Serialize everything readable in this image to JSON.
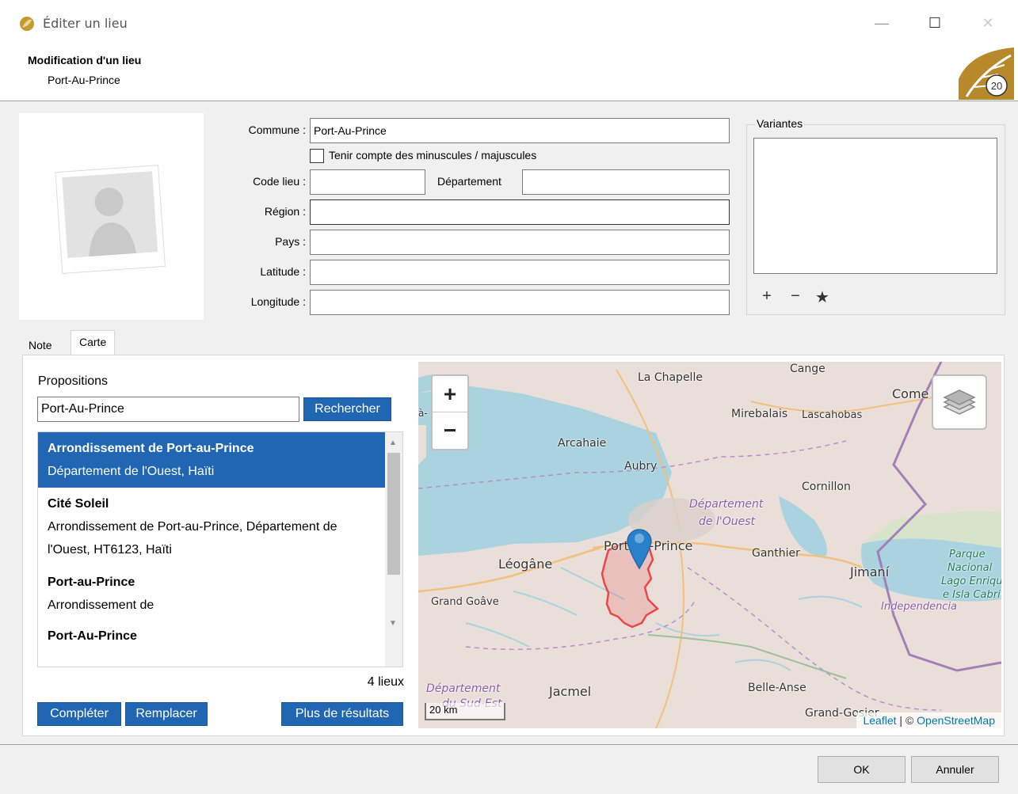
{
  "window": {
    "title": "Éditer un lieu",
    "minimize": "—",
    "maximize": "☐",
    "close": "✕"
  },
  "header": {
    "heading": "Modification d'un lieu",
    "subheading": "Port-Au-Prince"
  },
  "form": {
    "commune_label": "Commune :",
    "commune_value": "Port-Au-Prince",
    "case_label": "Tenir compte des minuscules / majuscules",
    "case_checked": false,
    "code_label": "Code lieu :",
    "code_value": "",
    "departement_label": "Département",
    "departement_value": "",
    "region_label": "Région :",
    "region_value": "",
    "pays_label": "Pays :",
    "pays_value": "",
    "latitude_label": "Latitude :",
    "latitude_value": "",
    "longitude_label": "Longitude :",
    "longitude_value": ""
  },
  "variantes": {
    "title": "Variantes",
    "add": "+",
    "remove": "−",
    "star": "★"
  },
  "tabs": [
    {
      "label": "Note"
    },
    {
      "label": "Carte"
    }
  ],
  "proposals": {
    "title": "Propositions",
    "query": "Port-Au-Prince",
    "search_button": "Rechercher",
    "items": [
      {
        "name": "Arrondissement de Port-au-Prince",
        "detail": "Département de l'Ouest, Haïti"
      },
      {
        "name": "Cité Soleil",
        "detail": "Arrondissement de Port-au-Prince, Département de l'Ouest, HT6123, Haïti"
      },
      {
        "name": "Port-au-Prince",
        "detail": "Arrondissement de"
      },
      {
        "name": "Port-Au-Prince",
        "detail": ""
      }
    ],
    "count": "4 lieux",
    "complete_button": "Compléter",
    "replace_button": "Remplacer",
    "more_button": "Plus de résultats"
  },
  "map": {
    "zoom_in": "+",
    "zoom_out": "−",
    "scale": "20 km",
    "attribution_leaflet": "Leaflet",
    "attribution_sep": " | © ",
    "attribution_osm": "OpenStreetMap",
    "labels": {
      "la_chapelle": "La Chapelle",
      "cange": "Cange",
      "comendador": "Come",
      "mirebalais": "Mirebalais",
      "lascahobas": "Lascahobas",
      "arcahaie": "Arcahaie",
      "aubry": "Aubry",
      "cornillon": "Cornillon",
      "dept_ouest_1": "Département",
      "dept_ouest_2": "de l'Ouest",
      "port_au_prince": "Port-au-Prince",
      "ganthier": "Ganthier",
      "jimani": "Jimaní",
      "leogane": "Léogâne",
      "grand_goave": "Grand Goâve",
      "parque_1": "Parque",
      "parque_2": "Nacional",
      "parque_3": "Lago Enriqui",
      "parque_4": "e Isla Cabrito",
      "independencia": "Independencia",
      "dept_sudest_1": "Département",
      "dept_sudest_2": "du Sud-Est",
      "jacmel": "Jacmel",
      "belle_anse": "Belle-Anse",
      "grand_gosier": "Grand-Gosier",
      "left_edge": "à-"
    },
    "colors": {
      "water": "#aad3df",
      "land": "#eadfd8",
      "boundary": "#e8474a"
    }
  },
  "footer": {
    "ok": "OK",
    "cancel": "Annuler"
  }
}
